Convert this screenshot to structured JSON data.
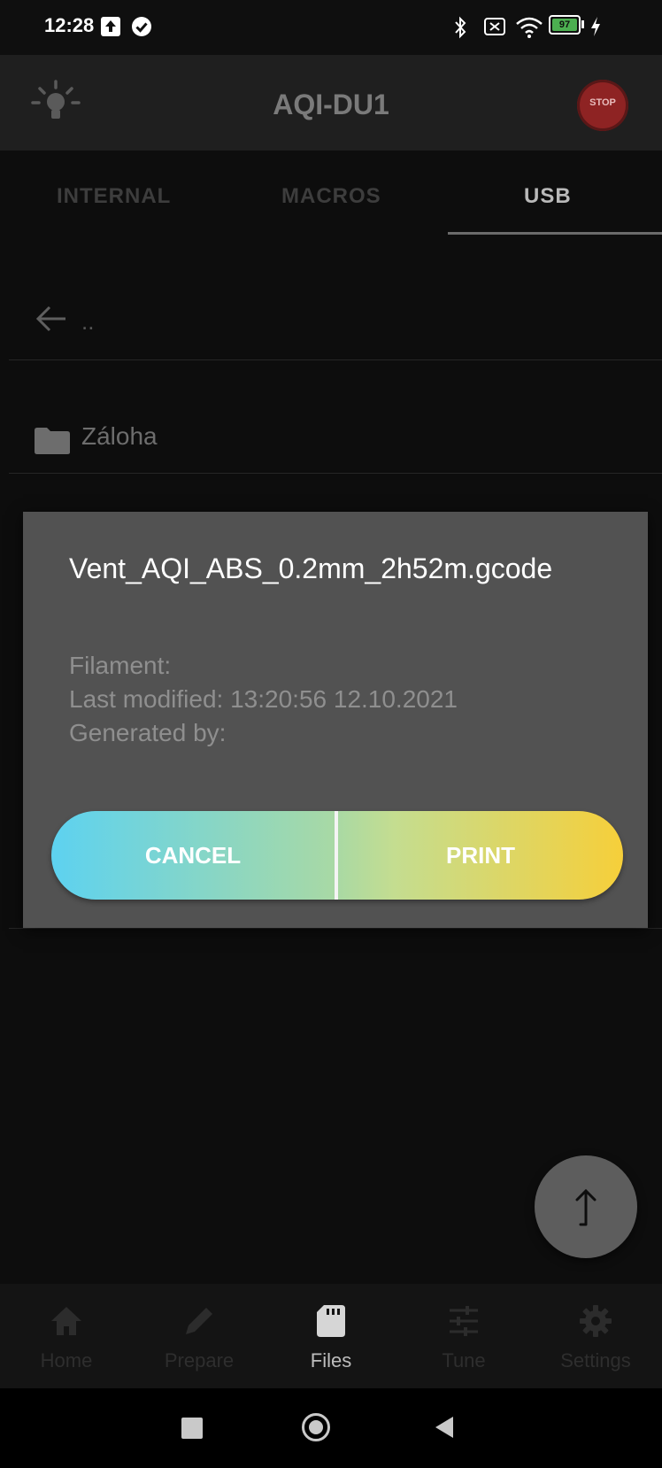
{
  "status_bar": {
    "time": "12:28",
    "battery_level": "97",
    "icons": [
      "upload-notification-icon",
      "check-circle-icon",
      "bluetooth-icon",
      "sim-off-icon",
      "wifi-icon",
      "battery-icon",
      "charging-icon"
    ]
  },
  "app_bar": {
    "title": "AQI-DU1",
    "left_icon": "light-bulb-icon",
    "stop_label": "STOP"
  },
  "tabs": [
    {
      "label": "INTERNAL",
      "active": false
    },
    {
      "label": "MACROS",
      "active": false
    },
    {
      "label": "USB",
      "active": true
    }
  ],
  "file_list": {
    "back_label": "..",
    "items": [
      {
        "type": "folder",
        "name": "Záloha"
      }
    ]
  },
  "dialog": {
    "file_name": "Vent_AQI_ABS_0.2mm_2h52m.gcode",
    "filament": "Filament:",
    "last_modified": "Last modified: 13:20:56 12.10.2021",
    "generated_by": "Generated by:",
    "cancel_label": "CANCEL",
    "print_label": "PRINT"
  },
  "fab": {
    "icon": "upload-arrow-icon"
  },
  "bottom_nav": [
    {
      "label": "Home",
      "icon": "home-icon",
      "active": false
    },
    {
      "label": "Prepare",
      "icon": "pencil-icon",
      "active": false
    },
    {
      "label": "Files",
      "icon": "sd-card-icon",
      "active": true
    },
    {
      "label": "Tune",
      "icon": "sliders-icon",
      "active": false
    },
    {
      "label": "Settings",
      "icon": "gear-icon",
      "active": false
    }
  ],
  "system_nav": [
    "recents-button",
    "home-button",
    "back-button"
  ],
  "colors": {
    "background": "#0d0d0d",
    "dialog": "#525252",
    "gradient_start": "#5dd2f0",
    "gradient_end": "#f6cf3a",
    "stop_red": "#8e2323"
  }
}
